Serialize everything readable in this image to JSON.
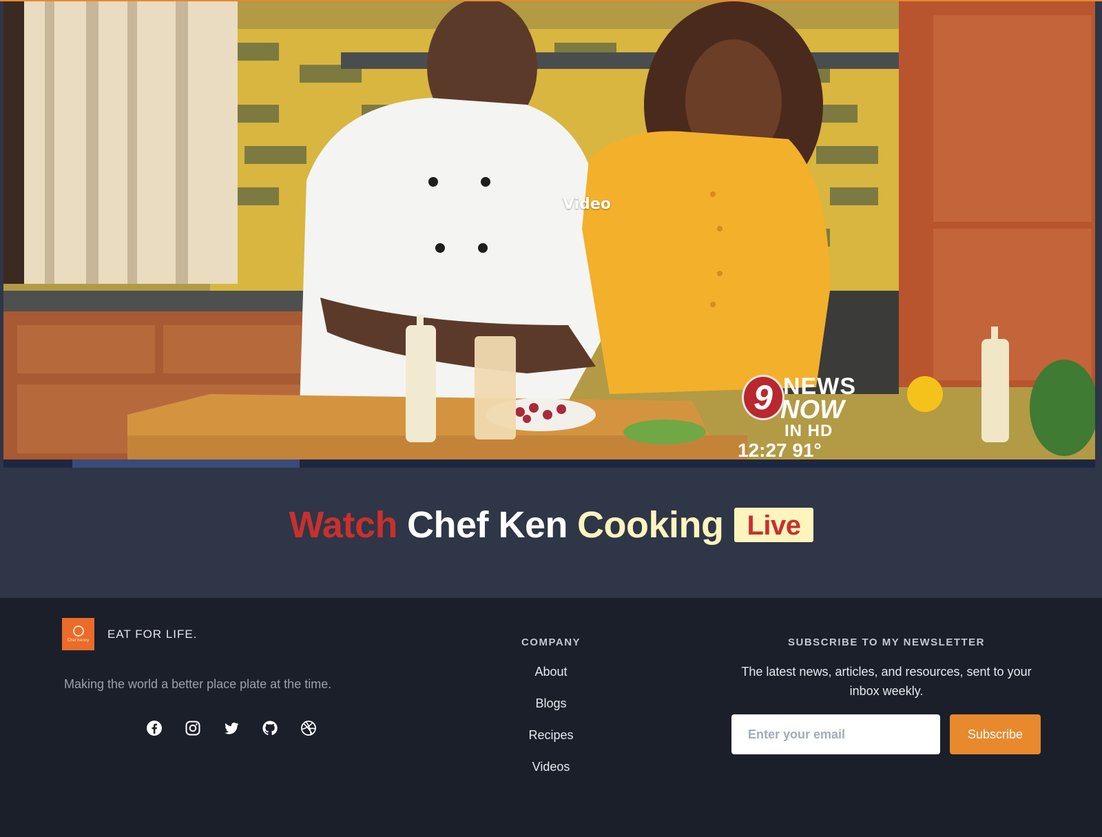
{
  "video": {
    "label": "Video",
    "station_logo": {
      "number": "9",
      "line1": "NEWS",
      "line2": "NOW",
      "line3": "IN HD",
      "time_temp": "12:27  91°"
    }
  },
  "live_banner": {
    "word_watch": "Watch",
    "word_name": "Chef Ken",
    "word_cooking": "Cooking",
    "badge": "Live"
  },
  "footer": {
    "brand": {
      "logo_text": "Chef Kenny",
      "name": "EAT FOR LIFE.",
      "tagline": "Making the world a better place plate at the time."
    },
    "socials": [
      {
        "icon": "facebook-icon"
      },
      {
        "icon": "instagram-icon"
      },
      {
        "icon": "twitter-icon"
      },
      {
        "icon": "github-icon"
      },
      {
        "icon": "dribbble-icon"
      }
    ],
    "company": {
      "title": "COMPANY",
      "links": [
        "About",
        "Blogs",
        "Recipes",
        "Videos"
      ]
    },
    "newsletter": {
      "title": "SUBSCRIBE TO MY NEWSLETTER",
      "description": "The latest news, articles, and resources, sent to your inbox weekly.",
      "email_placeholder": "Enter your email",
      "button_label": "Subscribe"
    }
  },
  "colors": {
    "accent_orange": "#e8892e",
    "headline_red": "#c8302e",
    "headline_cream": "#fdf4be",
    "banner_bg": "#2e3647",
    "footer_bg": "#1b1f2a"
  }
}
